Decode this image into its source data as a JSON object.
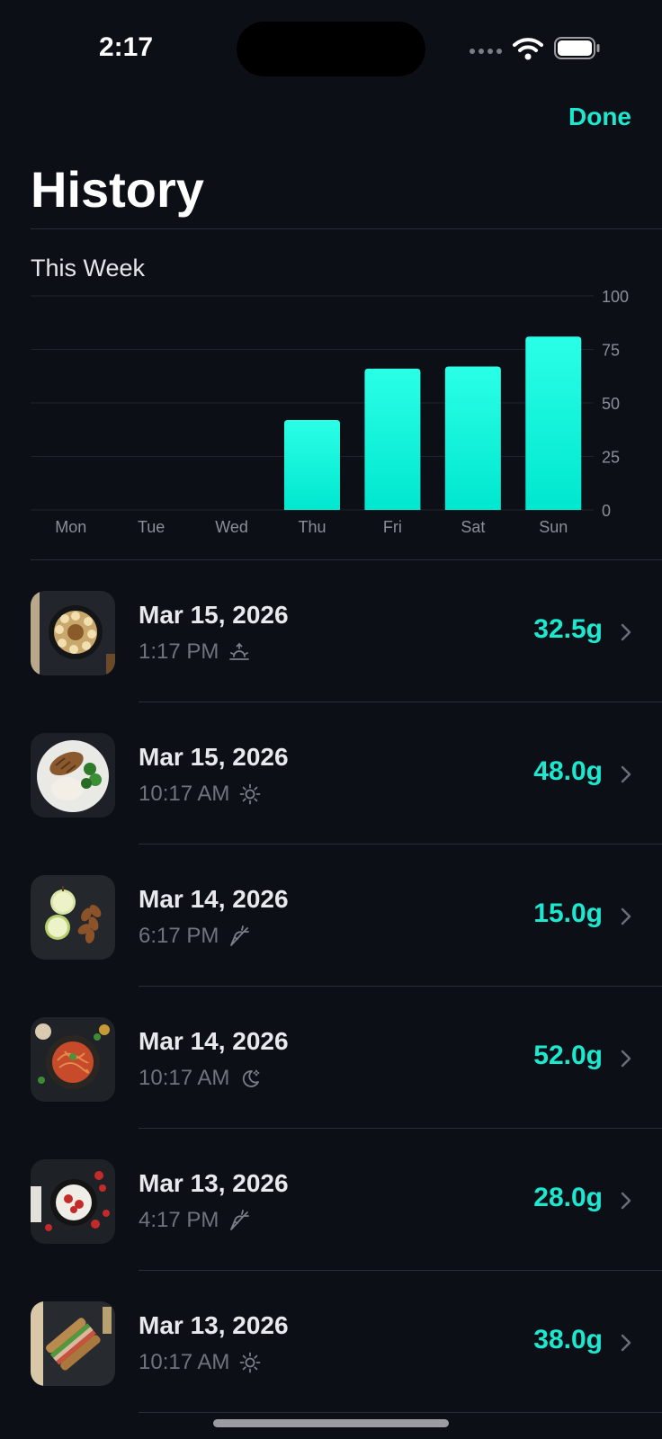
{
  "status_bar": {
    "time": "2:17"
  },
  "header": {
    "done_label": "Done",
    "title": "History"
  },
  "chart_section": {
    "title": "This Week"
  },
  "chart_data": {
    "type": "bar",
    "categories": [
      "Mon",
      "Tue",
      "Wed",
      "Thu",
      "Fri",
      "Sat",
      "Sun"
    ],
    "values": [
      0,
      0,
      0,
      42,
      66,
      67,
      81
    ],
    "ylim": [
      0,
      100
    ],
    "yticks": [
      0,
      25,
      50,
      75,
      100
    ],
    "grid": true,
    "bar_color": "#12ecd6"
  },
  "accent_color": "#1ce8d0",
  "entries": [
    {
      "date": "Mar 15, 2026",
      "time": "1:17 PM",
      "meal_icon": "sunrise-icon",
      "amount": "32.5g",
      "photo": "oatmeal-bowl"
    },
    {
      "date": "Mar 15, 2026",
      "time": "10:17 AM",
      "meal_icon": "sun-icon",
      "amount": "48.0g",
      "photo": "chicken-rice-broccoli"
    },
    {
      "date": "Mar 14, 2026",
      "time": "6:17 PM",
      "meal_icon": "carrot-icon",
      "amount": "15.0g",
      "photo": "apple-almonds"
    },
    {
      "date": "Mar 14, 2026",
      "time": "10:17 AM",
      "meal_icon": "moon-icon",
      "amount": "52.0g",
      "photo": "spaghetti"
    },
    {
      "date": "Mar 13, 2026",
      "time": "4:17 PM",
      "meal_icon": "carrot-icon",
      "amount": "28.0g",
      "photo": "yogurt-berries"
    },
    {
      "date": "Mar 13, 2026",
      "time": "10:17 AM",
      "meal_icon": "sun-icon",
      "amount": "38.0g",
      "photo": "sandwich"
    }
  ]
}
